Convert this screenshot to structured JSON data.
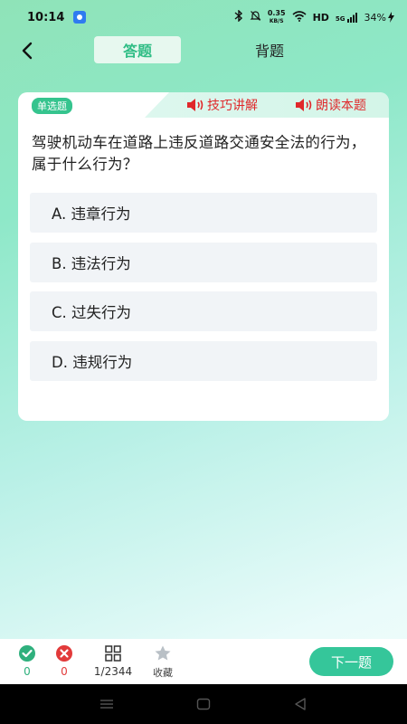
{
  "status": {
    "time": "10:14",
    "speed_value": "0.35",
    "speed_unit": "KB/S",
    "hd": "HD",
    "signal": "5G",
    "battery": "34%"
  },
  "nav": {
    "tab_answer": "答题",
    "tab_memorize": "背题"
  },
  "question": {
    "type_label": "单选题",
    "tips_label": "技巧讲解",
    "read_label": "朗读本题",
    "text": "驾驶机动车在道路上违反道路交通安全法的行为，属于什么行为？",
    "options": [
      {
        "label": "A. 违章行为"
      },
      {
        "label": "B. 违法行为"
      },
      {
        "label": "C. 过失行为"
      },
      {
        "label": "D. 违规行为"
      }
    ]
  },
  "bottom": {
    "correct_count": "0",
    "wrong_count": "0",
    "progress": "1/2344",
    "favorite_label": "收藏",
    "next_label": "下一题"
  },
  "colors": {
    "accent": "#35c48e",
    "danger": "#e0272a"
  }
}
